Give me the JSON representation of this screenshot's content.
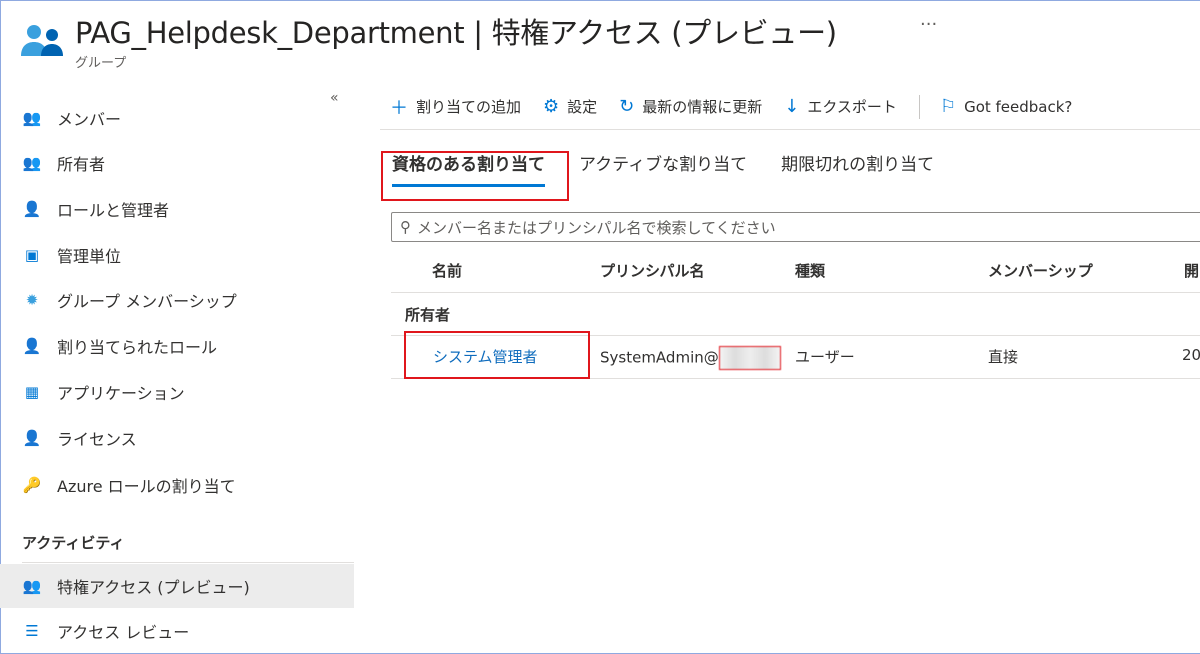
{
  "header": {
    "title": "PAG_Helpdesk_Department | 特権アクセス (プレビュー)",
    "subtitle": "グループ",
    "more": "···"
  },
  "sidebar": {
    "collapse": "«",
    "items": [
      {
        "label": "メンバー",
        "icon": "members-icon"
      },
      {
        "label": "所有者",
        "icon": "owners-icon"
      },
      {
        "label": "ロールと管理者",
        "icon": "roles-icon"
      },
      {
        "label": "管理単位",
        "icon": "admin-units-icon"
      },
      {
        "label": "グループ メンバーシップ",
        "icon": "group-membership-icon"
      },
      {
        "label": "割り当てられたロール",
        "icon": "assigned-roles-icon"
      },
      {
        "label": "アプリケーション",
        "icon": "applications-icon"
      },
      {
        "label": "ライセンス",
        "icon": "licenses-icon"
      },
      {
        "label": "Azure ロールの割り当て",
        "icon": "key-icon"
      }
    ],
    "section": "アクティビティ",
    "activity": [
      {
        "label": "特権アクセス (プレビュー)",
        "icon": "privileged-access-icon",
        "selected": true
      },
      {
        "label": "アクセス レビュー",
        "icon": "access-review-icon"
      }
    ]
  },
  "toolbar": {
    "add": "割り当ての追加",
    "settings": "設定",
    "refresh": "最新の情報に更新",
    "export": "エクスポート",
    "feedback": "Got feedback?"
  },
  "tabs": [
    "資格のある割り当て",
    "アクティブな割り当て",
    "期限切れの割り当て"
  ],
  "search": {
    "placeholder": "メンバー名またはプリンシパル名で検索してください"
  },
  "table": {
    "headers": [
      "名前",
      "プリンシパル名",
      "種類",
      "メンバーシップ",
      "開"
    ],
    "group": "所有者",
    "rows": [
      {
        "name": "システム管理者",
        "principal": "SystemAdmin@",
        "type": "ユーザー",
        "membership": "直接",
        "start": "20"
      }
    ]
  },
  "colors": {
    "accent": "#0078d4",
    "highlight": "#e0161c"
  }
}
